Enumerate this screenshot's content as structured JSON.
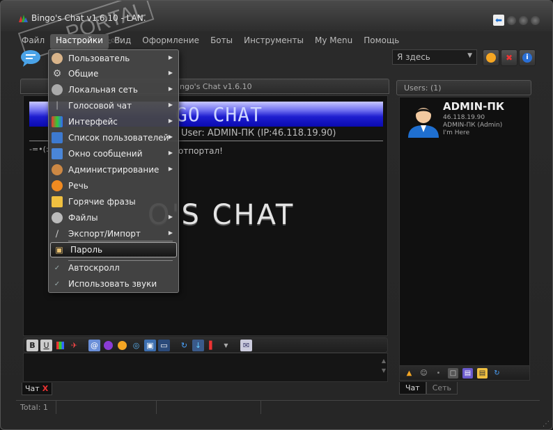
{
  "window": {
    "title": "Bingo's Chat v1.6.10 - LAN.",
    "watermark": "PORTAL",
    "watermark_url": "www.softportal.com"
  },
  "menubar": {
    "items": [
      "Файл",
      "Настройки",
      "Вид",
      "Оформление",
      "Боты",
      "Инструменты",
      "My Menu",
      "Помощь"
    ]
  },
  "toolbar": {
    "status_value": "Я здесь"
  },
  "chat": {
    "tab_caption": "ngo's Chat v1.6.10",
    "banner_text": "GO CHAT",
    "user_line": "User: ADMIN-ПК (IP:46.118.19.90)",
    "welcome_prefix": "-=•(:",
    "welcome_text": "отпортал!",
    "big_logo": "O'S CHAT",
    "bottom_tab": "Чат"
  },
  "settings_menu": {
    "items": [
      {
        "label": "Пользователь",
        "icon": "user-icon",
        "submenu": true
      },
      {
        "label": "Общие",
        "icon": "gear-icon",
        "submenu": true
      },
      {
        "label": "Локальная сеть",
        "icon": "network-icon",
        "submenu": true
      },
      {
        "label": "Голосовой чат",
        "icon": "microphone-icon",
        "submenu": true
      },
      {
        "label": "Интерфейс",
        "icon": "interface-icon",
        "submenu": true
      },
      {
        "label": "Список пользователей",
        "icon": "user-list-icon",
        "submenu": true
      },
      {
        "label": "Окно сообщений",
        "icon": "message-window-icon",
        "submenu": true
      },
      {
        "label": "Администрирование",
        "icon": "admin-icon",
        "submenu": true
      },
      {
        "label": "Речь",
        "icon": "speech-icon",
        "submenu": false
      },
      {
        "label": "Горячие фразы",
        "icon": "hot-phrases-icon",
        "submenu": false
      },
      {
        "label": "Файлы",
        "icon": "files-icon",
        "submenu": true
      },
      {
        "label": "Экспорт/Импорт",
        "icon": "export-import-icon",
        "submenu": true
      },
      {
        "label": "Пароль",
        "icon": "lock-icon",
        "submenu": false
      },
      {
        "label": "Автоскролл",
        "icon": "checkmark-icon",
        "submenu": false
      },
      {
        "label": "Использовать звуки",
        "icon": "checkmark-icon",
        "submenu": false
      }
    ]
  },
  "users": {
    "header": "Users: (1)",
    "list": [
      {
        "name": "ADMIN-ПК",
        "ip": "46.118.19.90",
        "role": "ADMIN-ПК (Admin)",
        "status": "I'm Here"
      }
    ],
    "tabs": [
      "Чат",
      "Сеть"
    ]
  },
  "statusbar": {
    "total": "Total: 1"
  }
}
